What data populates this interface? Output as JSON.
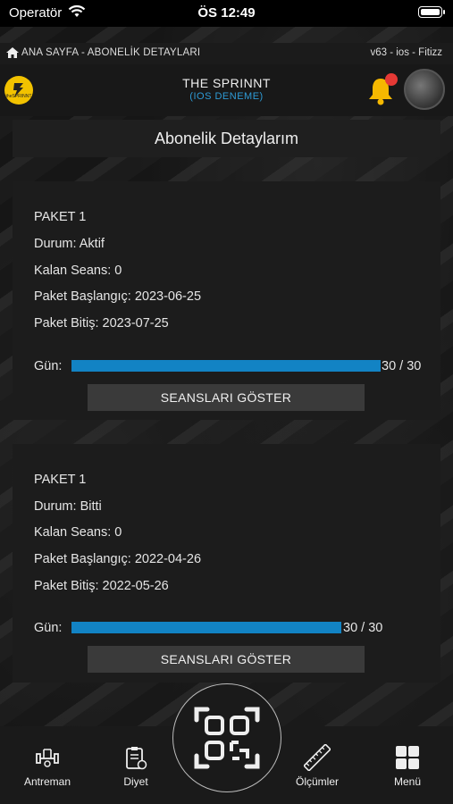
{
  "status_bar": {
    "carrier": "Operatör",
    "time": "ÖS 12:49"
  },
  "breadcrumb": {
    "path": "ANA SAYFA - ABONELİK DETAYLARI",
    "version": "v63 - ios -  Fitizz"
  },
  "header": {
    "brand": "THE SPRINNT",
    "subtitle": "(IOS DENEME)",
    "logo_text": "theSPRINNT"
  },
  "page": {
    "title": "Abonelik Detaylarım"
  },
  "packages": [
    {
      "name": "PAKET 1",
      "status": "Durum: Aktif",
      "remaining": "Kalan Seans: 0",
      "start": "Paket Başlangıç: 2023-06-25",
      "end": "Paket Bitiş: 2023-07-25",
      "day_label": "Gün:",
      "day_value": "30 / 30",
      "day_progress": 1.0,
      "button": "SEANSLARI GÖSTER"
    },
    {
      "name": "PAKET 1",
      "status": "Durum: Bitti",
      "remaining": "Kalan Seans: 0",
      "start": "Paket Başlangıç: 2022-04-26",
      "end": "Paket Bitiş: 2022-05-26",
      "day_label": "Gün:",
      "day_value": "30 / 30",
      "day_progress": 1.0,
      "button": "SEANSLARI GÖSTER"
    }
  ],
  "nav": {
    "training": "Antreman",
    "diet": "Diyet",
    "measurements": "Ölçümler",
    "menu": "Menü"
  },
  "colors": {
    "accent": "#1283c4",
    "bell": "#f5b800",
    "notification": "#e53935"
  }
}
